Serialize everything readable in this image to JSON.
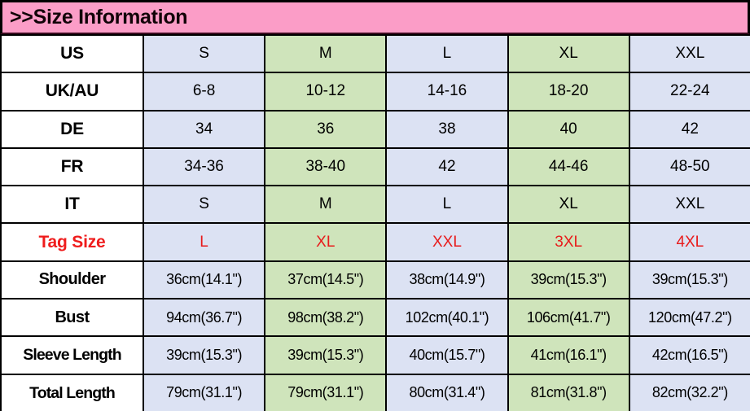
{
  "banner": {
    "title": ">>Size Information",
    "background_color": "#fb9dc7",
    "text_color": "#120308"
  },
  "colors": {
    "cell_blue": "#dce2f3",
    "cell_green": "#cfe4bb",
    "label_background": "#ffffff",
    "red_text": "#e81b1b",
    "border": "#000000"
  },
  "table": {
    "column_count": 6,
    "row_count": 10,
    "column_fills": [
      "white",
      "blue",
      "green",
      "blue",
      "green",
      "blue"
    ],
    "rows": [
      {
        "label": "US",
        "label_color": "black",
        "values": [
          "S",
          "M",
          "L",
          "XL",
          "XXL"
        ],
        "value_color": "black"
      },
      {
        "label": "UK/AU",
        "label_color": "black",
        "values": [
          "6-8",
          "10-12",
          "14-16",
          "18-20",
          "22-24"
        ],
        "value_color": "black"
      },
      {
        "label": "DE",
        "label_color": "black",
        "values": [
          "34",
          "36",
          "38",
          "40",
          "42"
        ],
        "value_color": "black"
      },
      {
        "label": "FR",
        "label_color": "black",
        "values": [
          "34-36",
          "38-40",
          "42",
          "44-46",
          "48-50"
        ],
        "value_color": "black"
      },
      {
        "label": "IT",
        "label_color": "black",
        "values": [
          "S",
          "M",
          "L",
          "XL",
          "XXL"
        ],
        "value_color": "black"
      },
      {
        "label": "Tag Size",
        "label_color": "red",
        "values": [
          "L",
          "XL",
          "XXL",
          "3XL",
          "4XL"
        ],
        "value_color": "red"
      },
      {
        "label": "Shoulder",
        "label_color": "black",
        "values": [
          "36cm(14.1\")",
          "37cm(14.5\")",
          "38cm(14.9\")",
          "39cm(15.3\")",
          "39cm(15.3\")"
        ],
        "value_color": "black"
      },
      {
        "label": "Bust",
        "label_color": "black",
        "values": [
          "94cm(36.7\")",
          "98cm(38.2\")",
          "102cm(40.1\")",
          "106cm(41.7\")",
          "120cm(47.2\")"
        ],
        "value_color": "black"
      },
      {
        "label": "Sleeve Length",
        "label_color": "black",
        "values": [
          "39cm(15.3\")",
          "39cm(15.3\")",
          "40cm(15.7\")",
          "41cm(16.1\")",
          "42cm(16.5\")"
        ],
        "value_color": "black"
      },
      {
        "label": "Total Length",
        "label_color": "black",
        "values": [
          "79cm(31.1\")",
          "79cm(31.1\")",
          "80cm(31.4\")",
          "81cm(31.8\")",
          "82cm(32.2\")"
        ],
        "value_color": "black"
      }
    ]
  }
}
